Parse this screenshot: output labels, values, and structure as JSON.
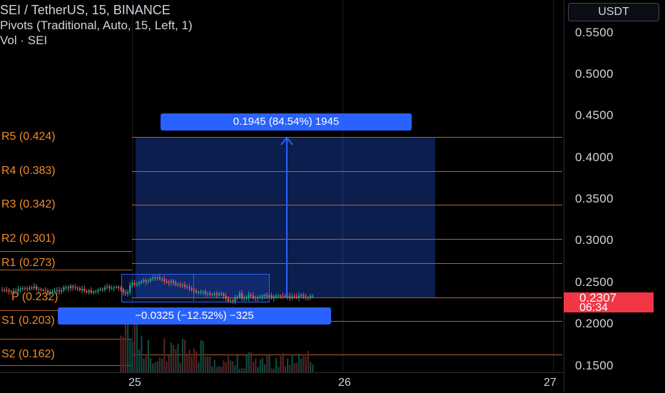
{
  "legend": {
    "symbol": "SEI / TetherUS, 15, BINANCE",
    "indicator": "Pivots (Traditional, Auto, 15, Left, 1)",
    "volume": "Vol · SEI"
  },
  "currency_button": "USDT",
  "price_axis": {
    "ticks": [
      "0.5500",
      "0.5000",
      "0.4500",
      "0.4000",
      "0.3500",
      "0.3000",
      "0.2500",
      "0.2000",
      "0.1500"
    ],
    "last_price": "0.2307",
    "countdown": "06:34"
  },
  "time_axis": {
    "ticks": [
      "25",
      "26",
      "27"
    ]
  },
  "pivots": [
    {
      "label": "R5 (0.424)"
    },
    {
      "label": "R4 (0.383)"
    },
    {
      "label": "R3 (0.342)"
    },
    {
      "label": "R2 (0.301)"
    },
    {
      "label": "R1 (0.273)"
    },
    {
      "label": "P (0.232)"
    },
    {
      "label": "S1 (0.203)"
    },
    {
      "label": "S2 (0.162)"
    }
  ],
  "measure_up": "0.1945 (84.54%) 1945",
  "measure_down": "−0.0325 (−12.52%) −325",
  "colors": {
    "pivot": "#f08a2a",
    "measure": "#2962ff",
    "up_candle": "#26a69a",
    "down_candle": "#ef5350",
    "last_price_bg": "#f23645"
  }
}
